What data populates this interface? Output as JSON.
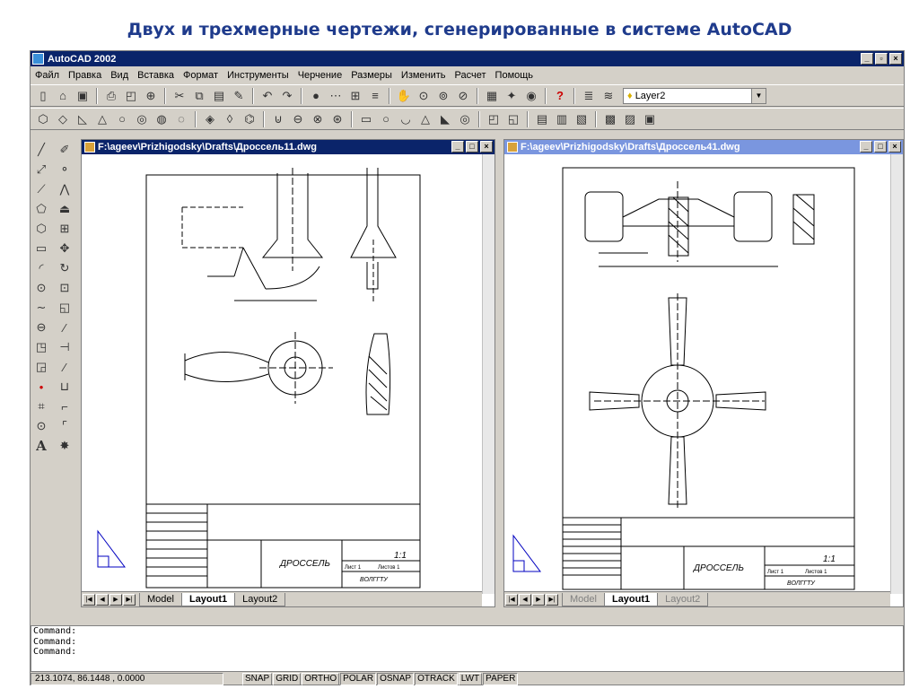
{
  "slide": {
    "title": "Двух и трехмерные чертежи, сгенерированные в системе AutoCAD"
  },
  "app": {
    "title": "AutoCAD 2002"
  },
  "menu": [
    "Файл",
    "Правка",
    "Вид",
    "Вставка",
    "Формат",
    "Инструменты",
    "Черчение",
    "Размеры",
    "Изменить",
    "Расчет",
    "Помощь"
  ],
  "toolbar": {
    "layer": "Layer2"
  },
  "windows": [
    {
      "title": "F:\\ageev\\Prizhigodsky\\Drafts\\Дроссель11.dwg",
      "stamp_name": "ДРОССЕЛЬ",
      "scale": "1:1",
      "org": "ВОЛГГТУ",
      "sheet": "Лист 1",
      "sheets": "Листов 1"
    },
    {
      "title": "F:\\ageev\\Prizhigodsky\\Drafts\\Дроссель41.dwg",
      "stamp_name": "ДРОССЕЛЬ",
      "scale": "1:1",
      "org": "ВОЛГГТУ",
      "sheet": "Лист 1",
      "sheets": "Листов 1"
    }
  ],
  "tabs": [
    "Model",
    "Layout1",
    "Layout2"
  ],
  "command_lines": [
    "Command:",
    "Command:",
    "Command:"
  ],
  "status": {
    "coords": "213.1074, 86.1448 , 0.0000",
    "buttons": [
      "SNAP",
      "GRID",
      "ORTHO",
      "POLAR",
      "OSNAP",
      "OTRACK",
      "LWT",
      "PAPER"
    ]
  },
  "colors": {
    "active_title": "#0a246a",
    "inactive_title": "#7a96df",
    "slide_title": "#1f3b8c"
  }
}
